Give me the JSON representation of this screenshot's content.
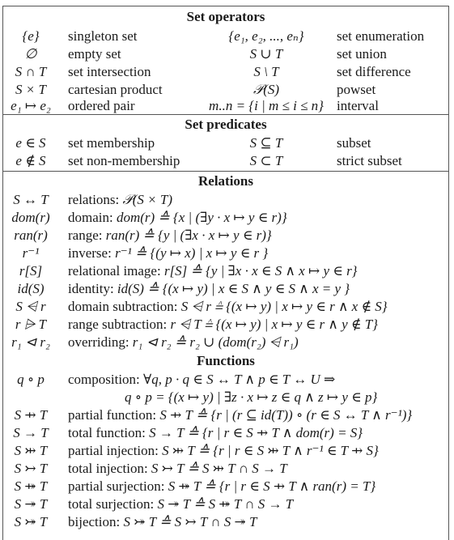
{
  "sections": {
    "set_operators": {
      "title": "Set operators",
      "rows": [
        {
          "sym1": "{e}",
          "desc1": "singleton set",
          "sym2": "{e₁, e₂, ..., eₙ}",
          "desc2": "set enumeration"
        },
        {
          "sym1": "∅",
          "desc1": "empty set",
          "sym2": "S ∪ T",
          "desc2": "set union"
        },
        {
          "sym1": "S ∩ T",
          "desc1": "set intersection",
          "sym2": "S \\ T",
          "desc2": "set difference"
        },
        {
          "sym1": "S × T",
          "desc1": "cartesian product",
          "sym2": "𝒫(S)",
          "desc2": "powset"
        },
        {
          "sym1": "e₁ ↦ e₂",
          "desc1": "ordered pair",
          "sym2": "m..n = {i | m ≤ i ≤ n}",
          "desc2": "interval"
        }
      ]
    },
    "set_predicates": {
      "title": "Set predicates",
      "rows": [
        {
          "sym1": "e ∈ S",
          "desc1": "set membership",
          "sym2": "S ⊆ T",
          "desc2": "subset"
        },
        {
          "sym1": "e ∉ S",
          "desc1": "set non-membership",
          "sym2": "S ⊂ T",
          "desc2": "strict subset"
        }
      ]
    },
    "relations": {
      "title": "Relations",
      "rows": [
        {
          "sym": "S ↔ T",
          "label": "relations:",
          "formula": "𝒫(S × T)"
        },
        {
          "sym": "dom(r)",
          "label": "domain:",
          "formula": "dom(r) ≙ {x | (∃y · x ↦ y ∈ r)}"
        },
        {
          "sym": "ran(r)",
          "label": "range:",
          "formula": "ran(r) ≙ {y | (∃x · x ↦ y ∈ r)}"
        },
        {
          "sym": "r⁻¹",
          "label": "inverse:",
          "formula": "r⁻¹ ≙ {(y ↦ x) | x ↦ y ∈ r }"
        },
        {
          "sym": "r[S]",
          "label": "relational image:",
          "formula": "r[S] ≙ {y | ∃x · x ∈ S ∧ x ↦ y ∈ r}"
        },
        {
          "sym": "id(S)",
          "label": "identity:",
          "formula": "id(S) ≙ {(x ↦ y) | x ∈ S ∧ y ∈ S ∧ x = y }"
        },
        {
          "sym": "S ⩤ r",
          "label": "domain subtraction:",
          "formula": "S ⩤ r ≙ {(x ↦ y) | x ↦ y ∈ r ∧ x ∉ S}"
        },
        {
          "sym": "r ⩥ T",
          "label": "range subtraction:",
          "formula": "r ⩤ T ≙ {(x ↦ y) | x ↦ y ∈ r ∧ y ∉ T}"
        },
        {
          "sym": "r₁ ⊲ r₂",
          "label": "overriding:",
          "formula": "r₁ ⊲ r₂ ≙ r₂ ∪ (dom(r₂) ⩤ r₁)"
        }
      ]
    },
    "functions": {
      "title": "Functions",
      "rows": [
        {
          "sym": "q ∘ p",
          "label": "composition:",
          "formula": "∀q, p · q ∈ S ↔ T ∧ p ∈ T ↔ U ⇒"
        },
        {
          "sym": "",
          "label": "",
          "formula": "q ∘ p = {(x ↦ y) | ∃z · x ↦ z ∈ q ∧ z ↦ y ∈ p}"
        },
        {
          "sym": "S ⇸ T",
          "label": "partial function:",
          "formula": "S ⇸ T ≙ {r | (r ⊆ id(T)) ∘ (r ∈ S ↔ T ∧ r⁻¹)}"
        },
        {
          "sym": "S → T",
          "label": "total function:",
          "formula": "S → T ≙ {r | r ∈ S ⇸ T ∧ dom(r) = S}"
        },
        {
          "sym": "S ⤔ T",
          "label": "partial injection:",
          "formula": "S ⤔ T ≙ {r | r ∈ S ⤔ T ∧ r⁻¹ ∈ T ⇸ S}"
        },
        {
          "sym": "S ↣ T",
          "label": "total injection:",
          "formula": "S ↣ T ≙ S ⤔ T ∩ S → T"
        },
        {
          "sym": "S ⤀ T",
          "label": "partial surjection:",
          "formula": "S ⤀ T ≙ {r | r ∈ S ⇸ T ∧ ran(r) = T}"
        },
        {
          "sym": "S ↠ T",
          "label": "total surjection:",
          "formula": "S ↠ T ≙ S ⤀ T ∩ S → T"
        },
        {
          "sym": "S ⤖ T",
          "label": "bijection:",
          "formula": "S ⤖ T ≙ S ↣ T ∩ S ↠ T"
        }
      ]
    }
  }
}
